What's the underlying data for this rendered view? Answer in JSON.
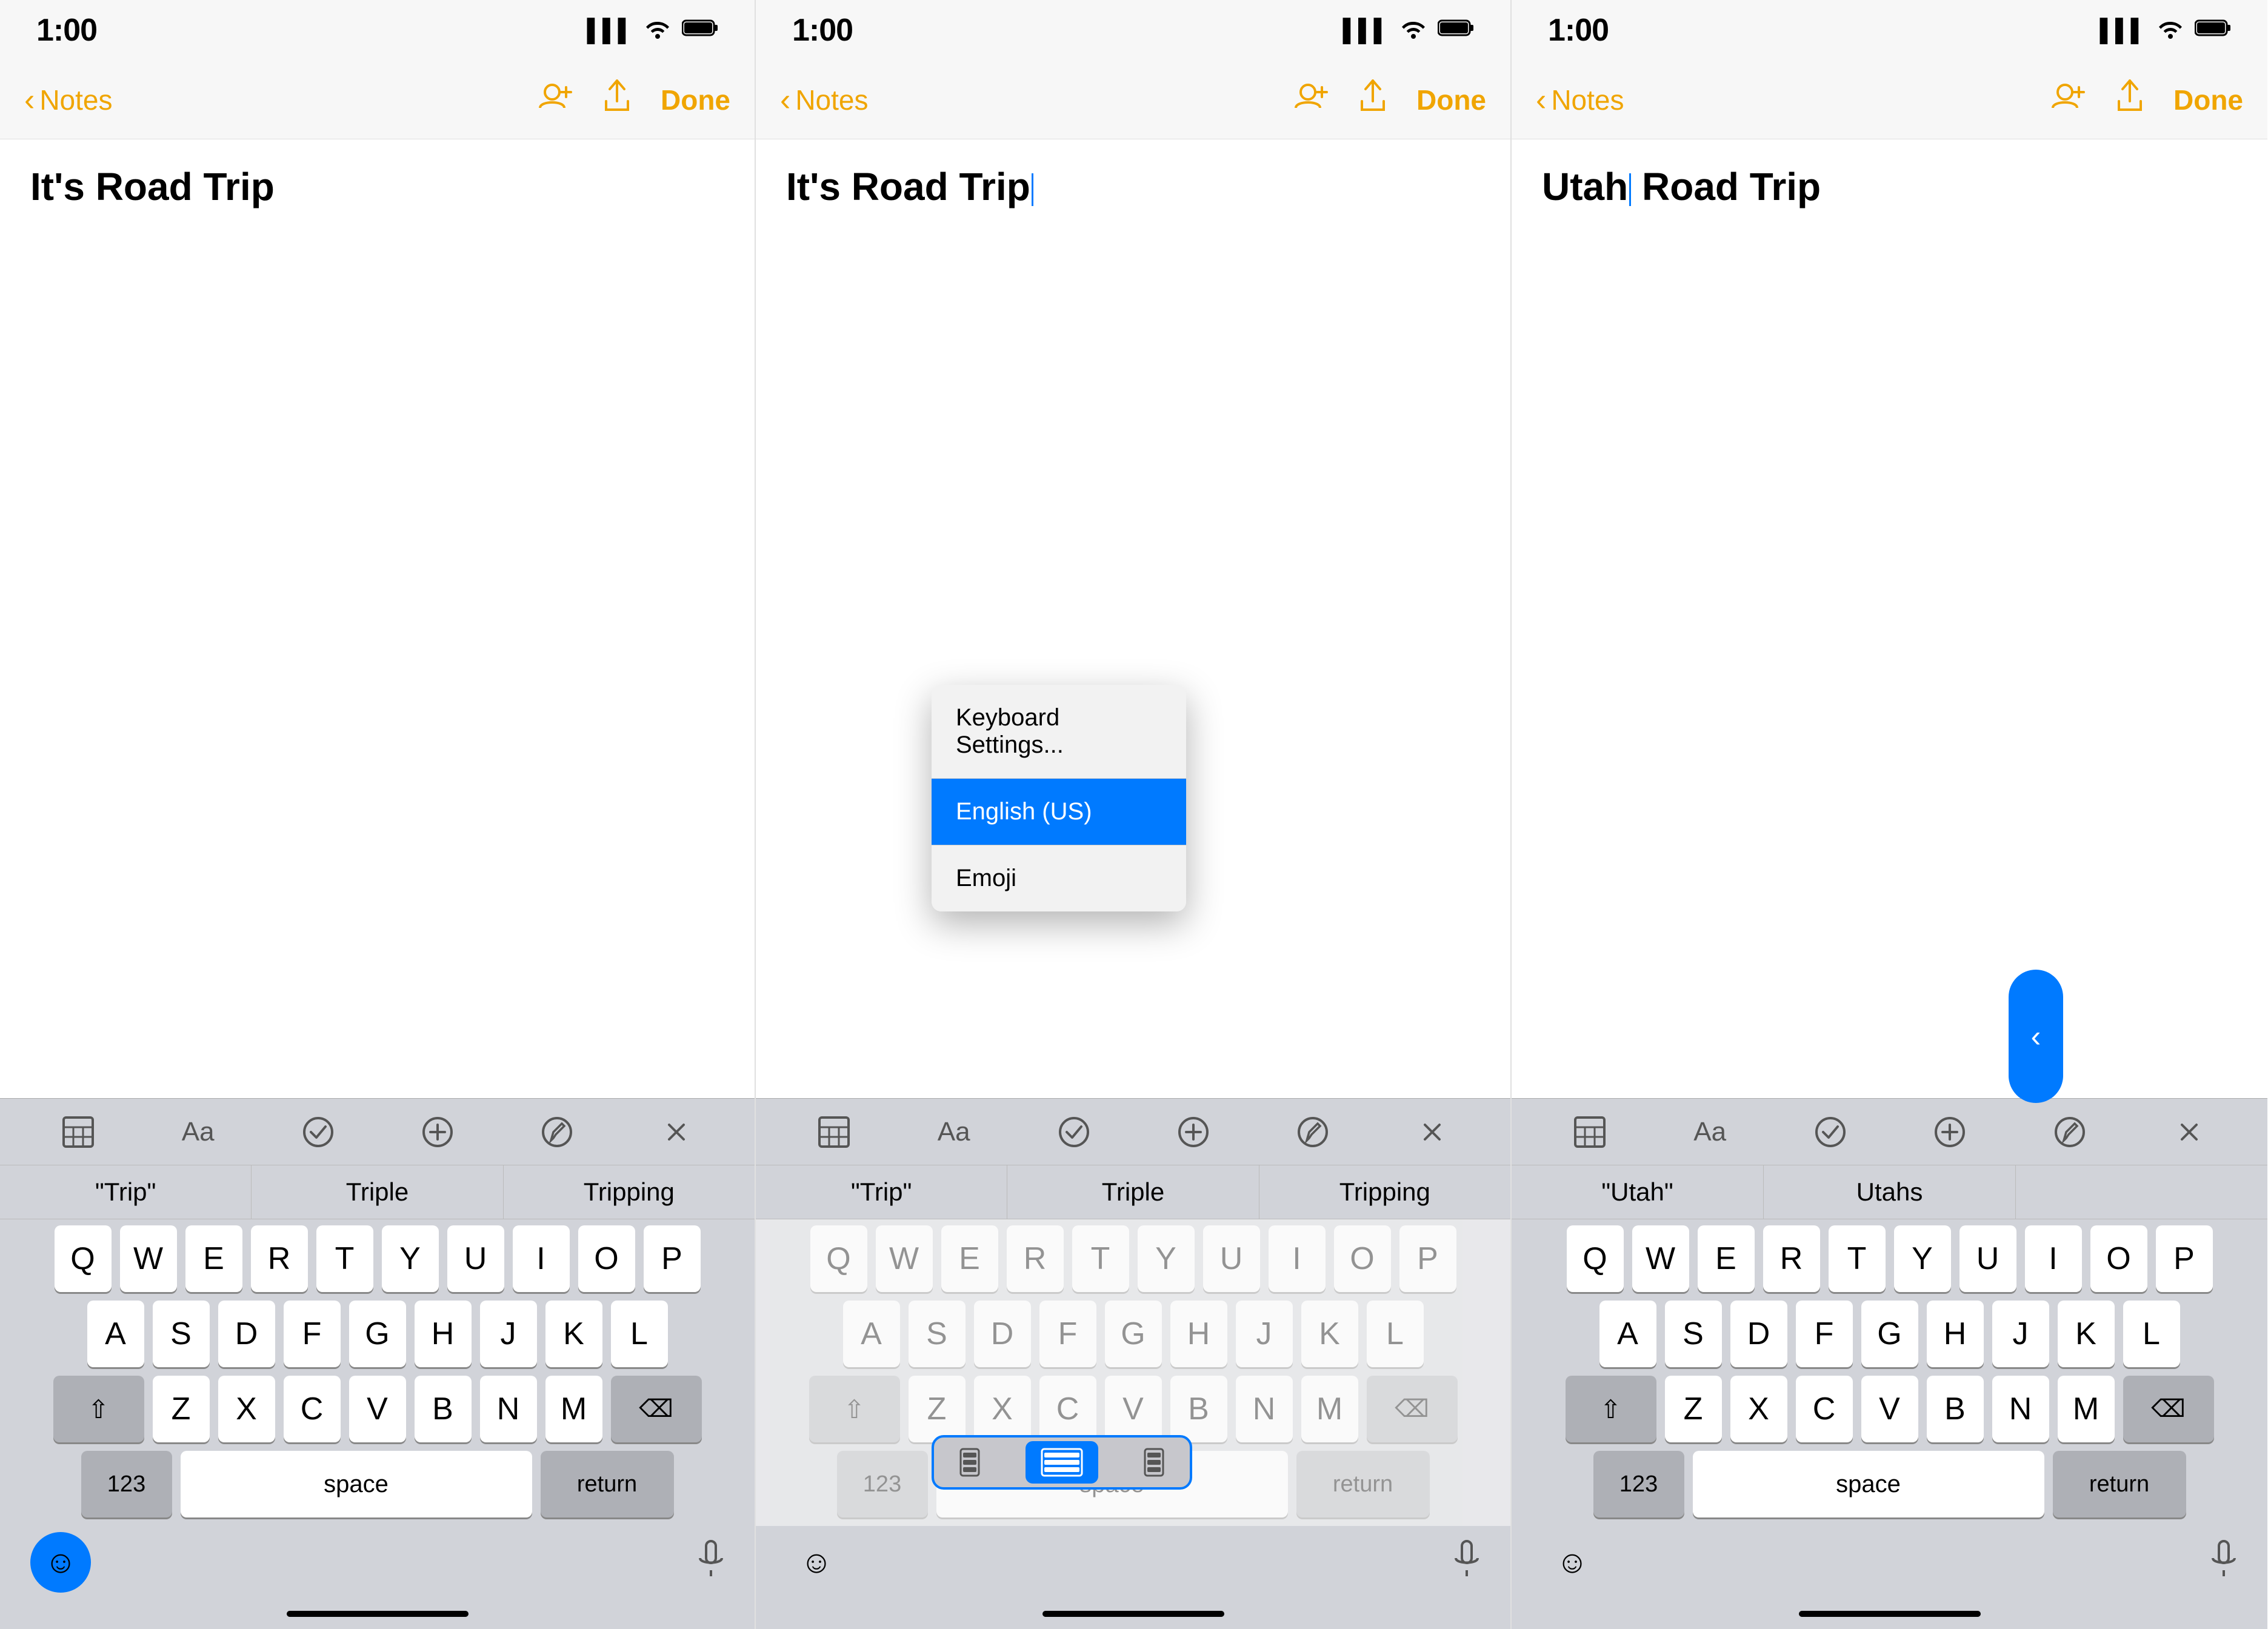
{
  "panels": [
    {
      "id": "panel1",
      "status": {
        "time": "1:00",
        "signal": "▌▌▌",
        "wifi": "wifi",
        "battery": "battery"
      },
      "nav": {
        "back_label": "Notes",
        "done_label": "Done"
      },
      "note_title": "It's Road Trip",
      "toolbar_icons": [
        "table",
        "Aa",
        "check",
        "plus",
        "pen",
        "x"
      ],
      "autocomplete": [
        "\"Trip\"",
        "Triple",
        "Tripping"
      ],
      "keyboard_rows": [
        [
          "Q",
          "W",
          "E",
          "R",
          "T",
          "Y",
          "U",
          "I",
          "O",
          "P"
        ],
        [
          "A",
          "S",
          "D",
          "F",
          "G",
          "H",
          "J",
          "K",
          "L"
        ],
        [
          "⇧",
          "Z",
          "X",
          "C",
          "V",
          "B",
          "N",
          "M",
          "⌫"
        ],
        [
          "123",
          "space",
          "return"
        ]
      ],
      "emoji_active": true,
      "show_cursor": false
    },
    {
      "id": "panel2",
      "status": {
        "time": "1:00"
      },
      "nav": {
        "back_label": "Notes",
        "done_label": "Done"
      },
      "note_title": "It's Road Trip",
      "show_cursor": true,
      "toolbar_icons": [
        "table",
        "Aa",
        "check",
        "plus",
        "pen",
        "x"
      ],
      "autocomplete": [
        "\"Trip\"",
        "Triple",
        "Tripping"
      ],
      "context_menu": {
        "items": [
          "Keyboard Settings...",
          "English (US)",
          "Emoji"
        ]
      },
      "keyboard_size_options": [
        "small-left",
        "full",
        "small-right"
      ],
      "keyboard_size_selected": 1
    },
    {
      "id": "panel3",
      "status": {
        "time": "1:00"
      },
      "nav": {
        "back_label": "Notes",
        "done_label": "Done"
      },
      "note_title": "Utah",
      "note_title2": "Road Trip",
      "show_cursor": true,
      "toolbar_icons": [
        "table",
        "Aa",
        "check",
        "plus",
        "pen",
        "x"
      ],
      "autocomplete": [
        "\"Utah\"",
        "Utahs"
      ],
      "keyboard_rows": [
        [
          "Q",
          "W",
          "E",
          "R",
          "T",
          "Y",
          "U",
          "I",
          "O",
          "P"
        ],
        [
          "A",
          "S",
          "D",
          "F",
          "G",
          "H",
          "J",
          "K",
          "L"
        ],
        [
          "⇧",
          "Z",
          "X",
          "C",
          "V",
          "B",
          "N",
          "M",
          "⌫"
        ],
        [
          "123",
          "space",
          "return"
        ]
      ],
      "floating_handle": true,
      "emoji_active": false
    }
  ]
}
